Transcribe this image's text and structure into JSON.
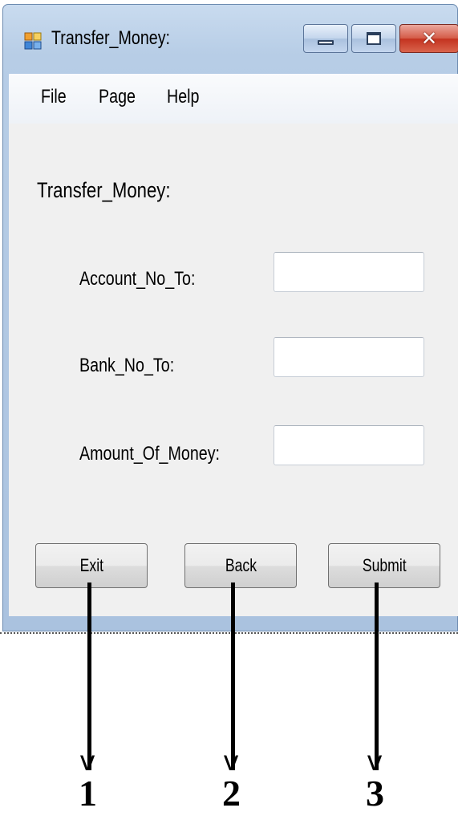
{
  "window": {
    "title": "Transfer_Money:",
    "controls": {
      "minimize": "minimize-icon",
      "maximize": "maximize-icon",
      "close": "close-icon"
    }
  },
  "menu": {
    "items": [
      "File",
      "Page",
      "Help"
    ]
  },
  "form": {
    "heading": "Transfer_Money:",
    "fields": [
      {
        "label": "Account_No_To:",
        "value": ""
      },
      {
        "label": "Bank_No_To:",
        "value": ""
      },
      {
        "label": "Amount_Of_Money:",
        "value": ""
      }
    ]
  },
  "buttons": {
    "exit": "Exit",
    "back": "Back",
    "submit": "Submit"
  },
  "annotations": [
    "1",
    "2",
    "3"
  ],
  "colors": {
    "close_red": "#c3321f",
    "client_bg": "#f0f0f0",
    "frame": "#aac2df"
  }
}
